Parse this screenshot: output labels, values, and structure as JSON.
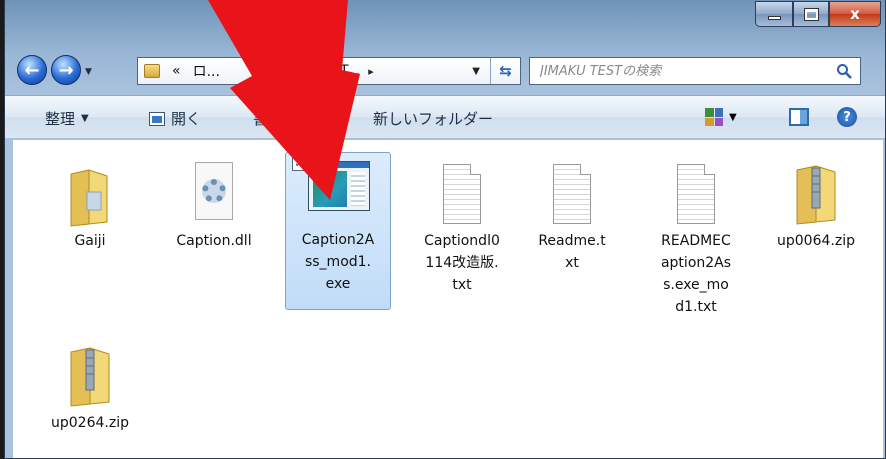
{
  "window": {
    "search_placeholder": "JIMAKU TESTの検索",
    "breadcrumb": [
      "«",
      "ロ...",
      "T..."
    ],
    "caption": {
      "close_label": "x"
    }
  },
  "toolbar": {
    "organize": "整理",
    "open": "開く",
    "burn": "書き",
    "new_folder": "新しいフォルダー",
    "help": "?"
  },
  "files": [
    {
      "name": "Gaiji",
      "type": "folder"
    },
    {
      "name": "Caption.dll",
      "type": "dll"
    },
    {
      "name": "Caption2Ass_mod1.exe",
      "type": "exe",
      "selected": true,
      "lines": [
        "Caption2A",
        "ss_mod1.",
        "exe"
      ]
    },
    {
      "name": "Captiondl0114改造版.txt",
      "type": "txt",
      "lines": [
        "Captiondl0",
        "114改造版.",
        "txt"
      ]
    },
    {
      "name": "Readme.txt",
      "type": "txt",
      "lines": [
        "Readme.t",
        "xt"
      ]
    },
    {
      "name": "READMECaption2Ass.exe_mod1.txt",
      "type": "txt",
      "lines": [
        "READMEC",
        "aption2As",
        "s.exe_mo",
        "d1.txt"
      ]
    },
    {
      "name": "up0064.zip",
      "type": "zip"
    },
    {
      "name": "up0264.zip",
      "type": "zip"
    }
  ],
  "colors": {
    "arrow": "#e8141a",
    "selection": "#c1dcf8",
    "titlebar": "#6b8fb5"
  }
}
